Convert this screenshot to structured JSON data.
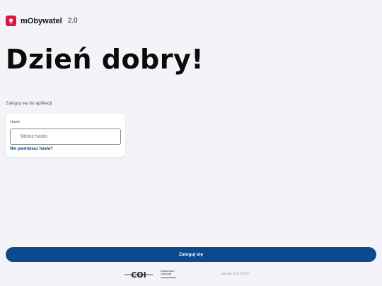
{
  "brand": {
    "icon": "eagle-emblem-icon",
    "name": "mObywatel",
    "version": "2.0",
    "accent_color": "#dc143c"
  },
  "greeting": "Dzień dobry!",
  "subtitle": "Zaloguj się do aplikacji.",
  "login_form": {
    "field_label": "Hasło",
    "password_placeholder": "Wpisz hasło",
    "password_value": "",
    "forgot_link": "Nie pamiętasz hasła?"
  },
  "login_button": {
    "label": "Zaloguj się",
    "color": "#0b4a8c"
  },
  "footer": {
    "coi_logo": "COI",
    "ministry_line1": "Ministerstwo",
    "ministry_line2": "Cyfryzacji",
    "version": "wersja 4.51.0 (27)"
  }
}
